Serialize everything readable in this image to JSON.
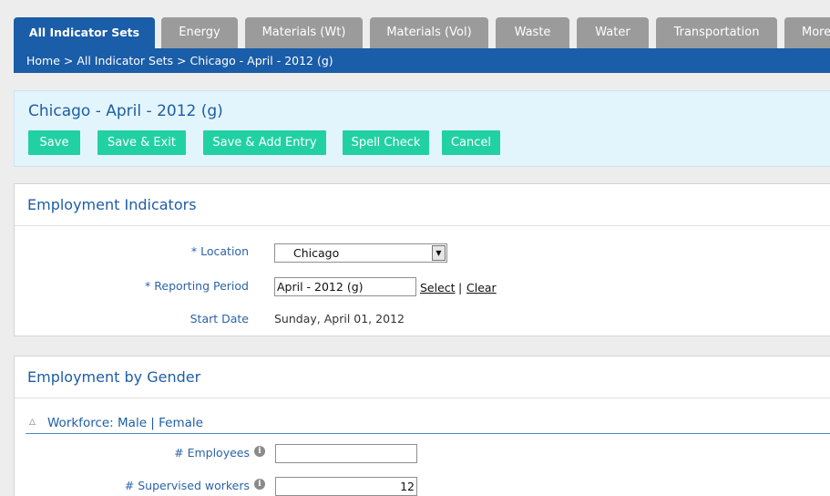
{
  "tabs": [
    {
      "label": "All Indicator Sets",
      "active": true
    },
    {
      "label": "Energy"
    },
    {
      "label": "Materials (Wt)"
    },
    {
      "label": "Materials (Vol)"
    },
    {
      "label": "Waste"
    },
    {
      "label": "Water"
    },
    {
      "label": "Transportation"
    },
    {
      "label": "More"
    }
  ],
  "breadcrumb": "Home > All Indicator Sets > Chicago - April - 2012 (g)",
  "page_title": "Chicago - April - 2012 (g)",
  "actions": {
    "save": "Save",
    "save_exit": "Save & Exit",
    "save_add": "Save & Add Entry",
    "spell_check": "Spell Check",
    "cancel": "Cancel"
  },
  "employment_indicators": {
    "title": "Employment Indicators",
    "location_label": "* Location",
    "location_value": "Chicago",
    "period_label": "* Reporting Period",
    "period_value": "April - 2012 (g)",
    "select_link": "Select",
    "separator": "|",
    "clear_link": "Clear",
    "start_label": "Start Date",
    "start_value": "Sunday, April 01, 2012"
  },
  "employment_by_gender": {
    "title": "Employment by Gender",
    "subsection": "Workforce: Male | Female",
    "employees_label": "# Employees",
    "employees_value": "",
    "supervised_label": "# Supervised workers",
    "supervised_value": "12",
    "info_icon": "i"
  },
  "colors": {
    "brand_blue": "#1a5da8",
    "tab_gray": "#9b9b9b",
    "button_green": "#22d1a3",
    "title_panel_bg": "#e3f5fc"
  },
  "icons": [
    "select-arrow-icon",
    "info-icon",
    "collapse-triangle-icon"
  ]
}
